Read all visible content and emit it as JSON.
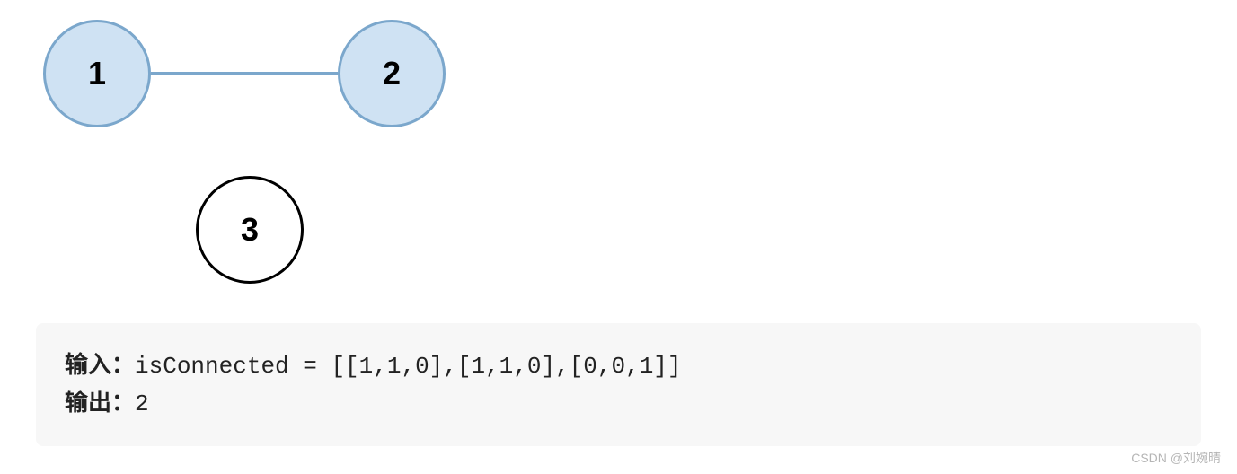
{
  "graph": {
    "nodes": [
      {
        "id": "1",
        "label": "1",
        "connected": true
      },
      {
        "id": "2",
        "label": "2",
        "connected": true
      },
      {
        "id": "3",
        "label": "3",
        "connected": false
      }
    ],
    "edges": [
      {
        "from": "1",
        "to": "2"
      }
    ]
  },
  "io": {
    "input_label": "输入：",
    "input_value": "isConnected = [[1,1,0],[1,1,0],[0,0,1]]",
    "output_label": "输出：",
    "output_value": "2"
  },
  "watermark": "CSDN @刘婉晴",
  "chart_data": {
    "type": "graph",
    "title": "",
    "nodes": [
      "1",
      "2",
      "3"
    ],
    "edges": [
      [
        "1",
        "2"
      ]
    ],
    "adjacency_matrix": [
      [
        1,
        1,
        0
      ],
      [
        1,
        1,
        0
      ],
      [
        0,
        0,
        1
      ]
    ],
    "connected_components": 2
  }
}
